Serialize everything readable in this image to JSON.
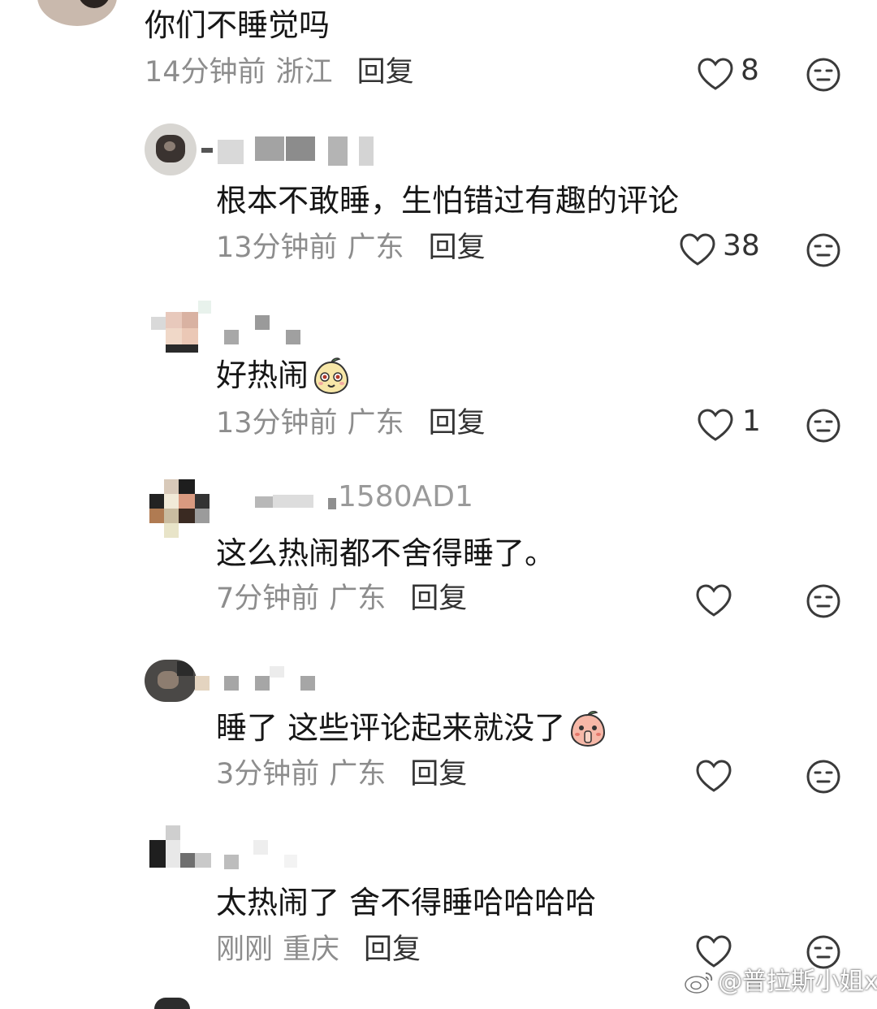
{
  "comments": [
    {
      "username": "",
      "text": "你们不睡觉吗",
      "time": "14分钟前",
      "location": "浙江",
      "reply": "回复",
      "likes": "8",
      "avatar_icon": "avatar-photo"
    },
    {
      "username": "",
      "text": "根本不敢睡，生怕错过有趣的评论",
      "time": "13分钟前",
      "location": "广东",
      "reply": "回复",
      "likes": "38",
      "avatar_icon": "avatar-cat-photo"
    },
    {
      "username": "",
      "text": "好热闹",
      "time": "13分钟前",
      "location": "广东",
      "reply": "回复",
      "likes": "1",
      "emoji": "pear-face-emoji"
    },
    {
      "username": "1580AD1",
      "text": "这么热闹都不舍得睡了。",
      "time": "7分钟前",
      "location": "广东",
      "reply": "回复",
      "likes": ""
    },
    {
      "username": "",
      "text": "睡了 这些评论起来就没了",
      "time": "3分钟前",
      "location": "广东",
      "reply": "回复",
      "likes": "",
      "emoji": "peach-shush-emoji"
    },
    {
      "username": "",
      "text": "太热闹了 舍不得睡哈哈哈哈",
      "time": "刚刚",
      "location": "重庆",
      "reply": "回复",
      "likes": ""
    }
  ],
  "watermark": "@普拉斯小姐x",
  "icons": {
    "like": "heart-outline-icon",
    "dislike": "neutral-face-icon",
    "watermark_logo": "weibo-logo-icon"
  },
  "colors": {
    "text": "#161616",
    "meta": "#8d8d8d",
    "icon": "#3a3a3a"
  }
}
